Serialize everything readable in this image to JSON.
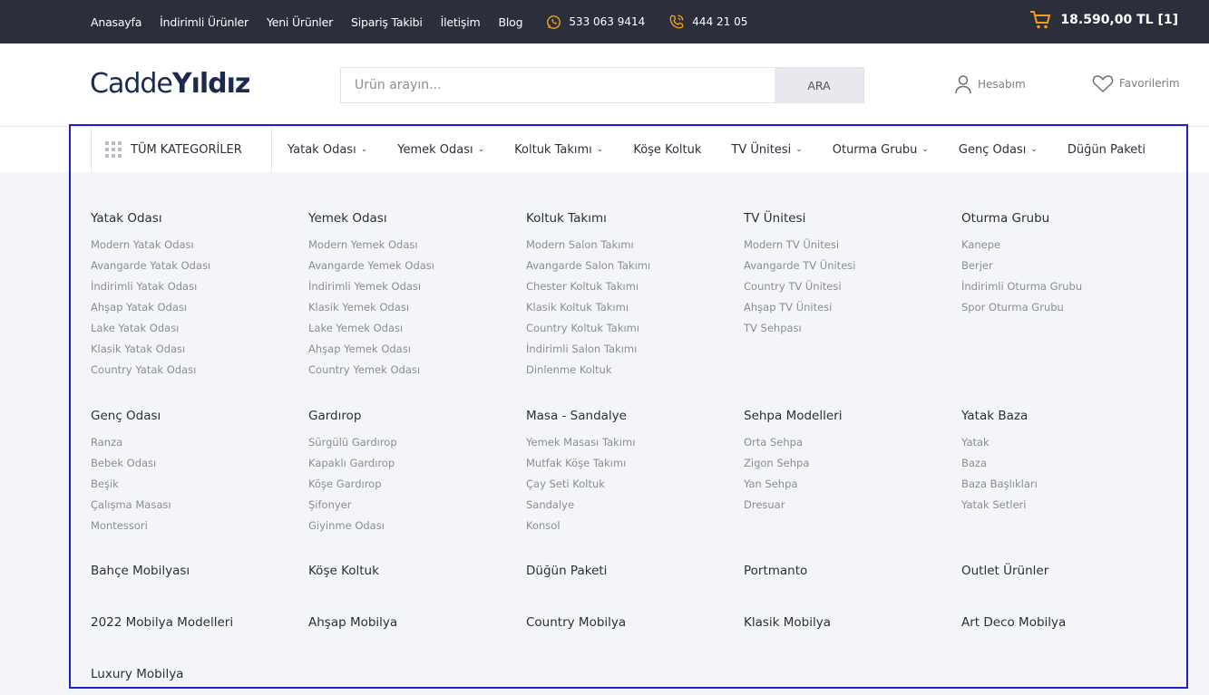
{
  "topbar": {
    "links": [
      "Anasayfa",
      "İndirimli Ürünler",
      "Yeni Ürünler",
      "Sipariş Takibi",
      "İletişim",
      "Blog"
    ],
    "whatsapp": "533 063 9414",
    "phone": "444 21 05",
    "cart_total": "18.590,00 TL [1]",
    "accent": "#f29d1d"
  },
  "header": {
    "logo_light": "Cadde",
    "logo_bold": "Yıldız",
    "search_placeholder": "Ürün arayın...",
    "search_button": "ARA",
    "account": "Hesabım",
    "favorites": "Favorilerim"
  },
  "catnav": {
    "all": "TÜM KATEGORİLER",
    "items": [
      {
        "label": "Yatak Odası",
        "chevron": "⌄"
      },
      {
        "label": "Yemek Odası",
        "chevron": "⌄"
      },
      {
        "label": "Koltuk Takımı",
        "chevron": "⌄"
      },
      {
        "label": "Köşe Koltuk",
        "chevron": ""
      },
      {
        "label": "TV Ünitesi",
        "chevron": "⌄"
      },
      {
        "label": "Oturma Grubu",
        "chevron": "⌄"
      },
      {
        "label": "Genç Odası",
        "chevron": "⌄"
      },
      {
        "label": "Düğün Paketi",
        "chevron": ""
      }
    ]
  },
  "mega": {
    "row1": [
      {
        "title": "Yatak Odası",
        "items": [
          "Modern Yatak Odası",
          "Avangarde Yatak Odası",
          "İndirimli Yatak Odası",
          "Ahşap Yatak Odası",
          "Lake Yatak Odası",
          "Klasik Yatak Odası",
          "Country Yatak Odası"
        ]
      },
      {
        "title": "Yemek Odası",
        "items": [
          "Modern Yemek Odası",
          "Avangarde Yemek Odası",
          "İndirimli Yemek Odası",
          "Klasik Yemek Odası",
          "Lake Yemek Odası",
          "Ahşap Yemek Odası",
          "Country Yemek Odası"
        ]
      },
      {
        "title": "Koltuk Takımı",
        "items": [
          "Modern Salon Takımı",
          "Avangarde Salon Takımı",
          "Chester Koltuk Takımı",
          "Klasik Koltuk Takımı",
          "Country Koltuk Takımı",
          "İndirimli Salon Takımı",
          "Dinlenme Koltuk"
        ]
      },
      {
        "title": "TV Ünitesi",
        "items": [
          "Modern TV Ünitesi",
          "Avangarde TV Ünitesi",
          "Country TV Ünitesi",
          "Ahşap TV Ünitesi",
          "TV Sehpası"
        ]
      },
      {
        "title": "Oturma Grubu",
        "items": [
          "Kanepe",
          "Berjer",
          "İndirimli Oturma Grubu",
          "Spor Oturma Grubu"
        ]
      }
    ],
    "row2": [
      {
        "title": "Genç Odası",
        "items": [
          "Ranza",
          "Bebek Odası",
          "Beşik",
          "Çalışma Masası",
          "Montessori"
        ]
      },
      {
        "title": "Gardırop",
        "items": [
          "Sürgülü Gardırop",
          "Kapaklı Gardırop",
          "Köşe Gardırop",
          "Şifonyer",
          "Giyinme Odası"
        ]
      },
      {
        "title": "Masa - Sandalye",
        "items": [
          "Yemek Masası Takımı",
          "Mutfak Köşe Takımı",
          "Çay Seti Koltuk",
          "Sandalye",
          "Konsol"
        ]
      },
      {
        "title": "Sehpa Modelleri",
        "items": [
          "Orta Sehpa",
          "Zigon Sehpa",
          "Yan Sehpa",
          "Dresuar"
        ]
      },
      {
        "title": "Yatak Baza",
        "items": [
          "Yatak",
          "Baza",
          "Baza Başlıkları",
          "Yatak Setleri"
        ]
      }
    ],
    "row3": [
      "Bahçe Mobilyası",
      "Köşe Koltuk",
      "Düğün Paketi",
      "Portmanto",
      "Outlet Ürünler"
    ],
    "row4": [
      "2022 Mobilya Modelleri",
      "Ahşap Mobilya",
      "Country Mobilya",
      "Klasik Mobilya",
      "Art Deco Mobilya"
    ],
    "row5": [
      "Luxury Mobilya"
    ]
  }
}
